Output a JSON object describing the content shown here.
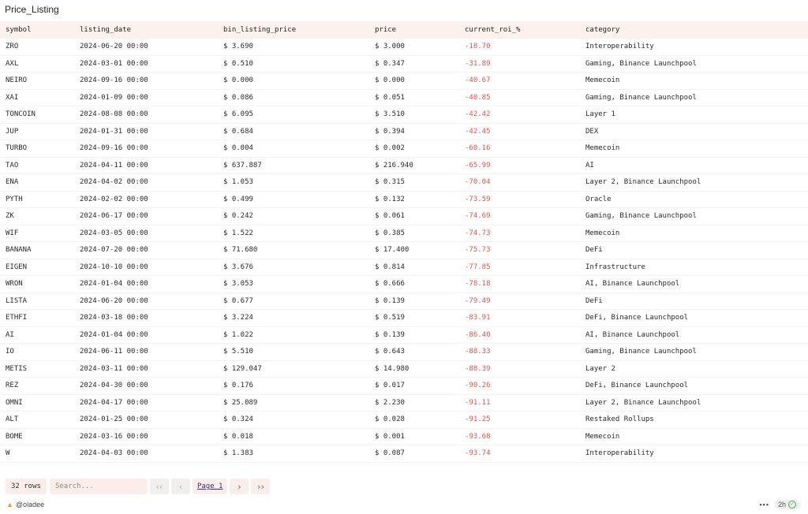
{
  "title": "Price_Listing",
  "columns": [
    "symbol",
    "listing_date",
    "bin_listing_price",
    "price",
    "current_roi_%",
    "category"
  ],
  "rows": [
    [
      "ZRO",
      "2024-06-20 00:00",
      "$ 3.690",
      "$ 3.000",
      "-18.70",
      "Interoperability"
    ],
    [
      "AXL",
      "2024-03-01 00:00",
      "$ 0.510",
      "$ 0.347",
      "-31.89",
      "Gaming, Binance Launchpool"
    ],
    [
      "NEIRO",
      "2024-09-16 00:00",
      "$ 0.000",
      "$ 0.000",
      "-40.67",
      "Memecoin"
    ],
    [
      "XAI",
      "2024-01-09 00:00",
      "$ 0.086",
      "$ 0.051",
      "-40.85",
      "Gaming, Binance Launchpool"
    ],
    [
      "TONCOIN",
      "2024-08-08 00:00",
      "$ 6.095",
      "$ 3.510",
      "-42.42",
      "Layer 1"
    ],
    [
      "JUP",
      "2024-01-31 00:00",
      "$ 0.684",
      "$ 0.394",
      "-42.45",
      "DEX"
    ],
    [
      "TURBO",
      "2024-09-16 00:00",
      "$ 0.004",
      "$ 0.002",
      "-60.16",
      "Memecoin"
    ],
    [
      "TAO",
      "2024-04-11 00:00",
      "$ 637.887",
      "$ 216.940",
      "-65.99",
      "AI"
    ],
    [
      "ENA",
      "2024-04-02 00:00",
      "$ 1.053",
      "$ 0.315",
      "-70.04",
      "Layer 2, Binance Launchpool"
    ],
    [
      "PYTH",
      "2024-02-02 00:00",
      "$ 0.499",
      "$ 0.132",
      "-73.59",
      "Oracle"
    ],
    [
      "ZK",
      "2024-06-17 00:00",
      "$ 0.242",
      "$ 0.061",
      "-74.69",
      "Gaming, Binance Launchpool"
    ],
    [
      "WIF",
      "2024-03-05 00:00",
      "$ 1.522",
      "$ 0.385",
      "-74.73",
      "Memecoin"
    ],
    [
      "BANANA",
      "2024-07-20 00:00",
      "$ 71.680",
      "$ 17.400",
      "-75.73",
      "DeFi"
    ],
    [
      "EIGEN",
      "2024-10-10 00:00",
      "$ 3.676",
      "$ 0.814",
      "-77.85",
      "Infrastructure"
    ],
    [
      "WRON",
      "2024-01-04 00:00",
      "$ 3.053",
      "$ 0.666",
      "-78.18",
      "AI, Binance Launchpool"
    ],
    [
      "LISTA",
      "2024-06-20 00:00",
      "$ 0.677",
      "$ 0.139",
      "-79.49",
      "DeFi"
    ],
    [
      "ETHFI",
      "2024-03-18 00:00",
      "$ 3.224",
      "$ 0.519",
      "-83.91",
      "DeFi, Binance Launchpool"
    ],
    [
      "AI",
      "2024-01-04 00:00",
      "$ 1.022",
      "$ 0.139",
      "-86.40",
      "AI, Binance Launchpool"
    ],
    [
      "IO",
      "2024-06-11 00:00",
      "$ 5.510",
      "$ 0.643",
      "-88.33",
      "Gaming, Binance Launchpool"
    ],
    [
      "METIS",
      "2024-03-11 00:00",
      "$ 129.047",
      "$ 14.980",
      "-88.39",
      "Layer 2"
    ],
    [
      "REZ",
      "2024-04-30 00:00",
      "$ 0.176",
      "$ 0.017",
      "-90.26",
      "DeFi, Binance Launchpool"
    ],
    [
      "OMNI",
      "2024-04-17 00:00",
      "$ 25.089",
      "$ 2.230",
      "-91.11",
      "Layer 2, Binance Launchpool"
    ],
    [
      "ALT",
      "2024-01-25 00:00",
      "$ 0.324",
      "$ 0.028",
      "-91.25",
      "Restaked Rollups"
    ],
    [
      "BOME",
      "2024-03-16 00:00",
      "$ 0.018",
      "$ 0.001",
      "-93.68",
      "Memecoin"
    ],
    [
      "W",
      "2024-04-03 00:00",
      "$ 1.383",
      "$ 0.087",
      "-93.74",
      "Interoperability"
    ]
  ],
  "pagination": {
    "rows_count": "32 rows",
    "search_placeholder": "Search...",
    "page_label": "Page 1",
    "first_icon": "chevrons-left-icon",
    "prev_icon": "chevron-left-icon",
    "next_icon": "chevron-right-icon",
    "last_icon": "chevrons-right-icon"
  },
  "footer": {
    "author": "@oladee",
    "age": "2h"
  },
  "colors": {
    "negative": "#e0524d",
    "header_bg": "#fdf1ee",
    "link": "#3d2a7a"
  }
}
